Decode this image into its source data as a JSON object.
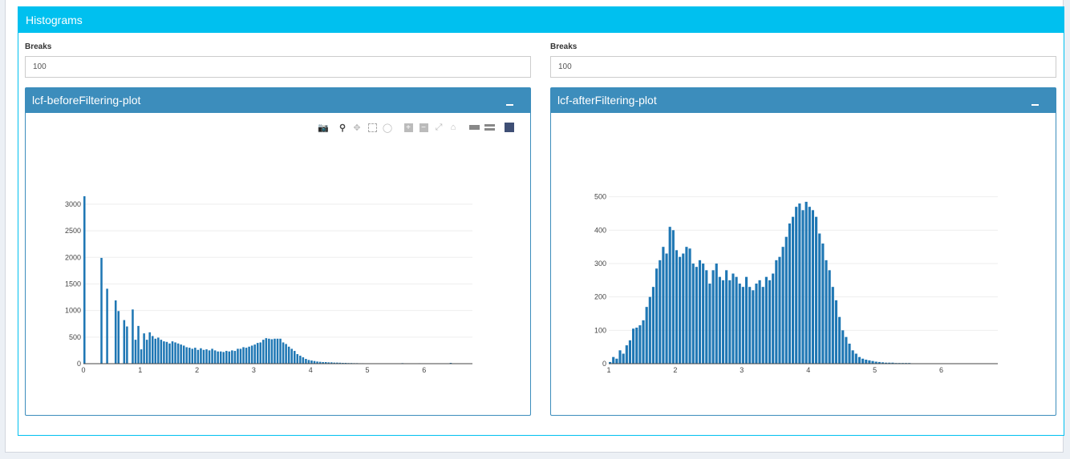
{
  "main_box": {
    "title": "Histograms"
  },
  "left": {
    "breaks_label": "Breaks",
    "breaks_value": "100",
    "plot_title": "lcf-beforeFiltering-plot"
  },
  "right": {
    "breaks_label": "Breaks",
    "breaks_value": "100",
    "plot_title": "lcf-afterFiltering-plot"
  },
  "modebar": [
    "camera-icon",
    "zoom-icon",
    "pan-icon",
    "box-select-icon",
    "lasso-icon",
    "zoom-in-icon",
    "zoom-out-icon",
    "autoscale-icon",
    "reset-axes-icon",
    "spike-lines-icon",
    "compare-hover-icon",
    "plotly-logo-icon"
  ],
  "colors": {
    "header": "#00c0ef",
    "plot_header": "#3c8dbc",
    "bar": "#1f77b4"
  },
  "chart_data": [
    {
      "type": "bar",
      "title": "",
      "xlabel": "",
      "ylabel": "",
      "xlim": [
        0,
        6.85
      ],
      "ylim": [
        0,
        3300
      ],
      "xticks": [
        0,
        1,
        2,
        3,
        4,
        5,
        6
      ],
      "yticks": [
        0,
        500,
        1000,
        1500,
        2000,
        2500,
        3000
      ],
      "bin_width": 0.05,
      "x_start": 0,
      "values": [
        3150,
        0,
        0,
        0,
        0,
        0,
        1990,
        0,
        1410,
        0,
        0,
        1190,
        990,
        0,
        820,
        700,
        0,
        1020,
        450,
        710,
        270,
        570,
        450,
        590,
        520,
        470,
        490,
        450,
        420,
        410,
        380,
        420,
        400,
        380,
        360,
        340,
        310,
        300,
        280,
        300,
        260,
        290,
        260,
        270,
        250,
        280,
        250,
        230,
        230,
        220,
        240,
        230,
        250,
        240,
        280,
        280,
        310,
        300,
        320,
        340,
        360,
        390,
        400,
        450,
        480,
        470,
        460,
        470,
        470,
        470,
        400,
        370,
        320,
        280,
        240,
        180,
        150,
        120,
        90,
        70,
        60,
        50,
        40,
        35,
        30,
        30,
        25,
        25,
        20,
        20,
        18,
        15,
        15,
        12,
        12,
        10,
        10,
        8,
        8,
        6,
        6,
        5,
        5,
        4,
        4,
        3,
        3,
        3,
        2,
        2,
        2,
        2,
        10,
        0,
        0,
        5,
        0,
        0,
        8,
        0,
        0,
        0,
        0,
        0,
        0,
        0,
        0,
        0,
        0,
        15
      ]
    },
    {
      "type": "bar",
      "title": "",
      "xlabel": "",
      "ylabel": "",
      "xlim": [
        1,
        6.85
      ],
      "ylim": [
        0,
        540
      ],
      "xticks": [
        1,
        2,
        3,
        4,
        5,
        6
      ],
      "yticks": [
        0,
        100,
        200,
        300,
        400,
        500
      ],
      "bin_width": 0.05,
      "x_start": 1,
      "values": [
        5,
        20,
        15,
        40,
        30,
        55,
        70,
        105,
        108,
        115,
        130,
        170,
        200,
        230,
        285,
        310,
        350,
        330,
        410,
        400,
        340,
        320,
        330,
        350,
        345,
        300,
        290,
        310,
        300,
        280,
        240,
        280,
        300,
        260,
        250,
        280,
        250,
        270,
        260,
        240,
        230,
        260,
        230,
        220,
        240,
        250,
        230,
        260,
        250,
        270,
        310,
        320,
        350,
        380,
        420,
        440,
        470,
        480,
        460,
        485,
        470,
        460,
        440,
        390,
        360,
        310,
        280,
        230,
        190,
        140,
        100,
        80,
        60,
        40,
        30,
        20,
        15,
        12,
        10,
        8,
        6,
        5,
        4,
        3,
        3,
        3,
        2,
        2,
        2,
        2,
        2,
        1,
        1,
        1,
        1,
        1,
        1,
        1,
        1,
        1,
        1,
        1,
        1,
        1,
        1,
        1,
        1,
        1,
        1,
        1,
        1,
        1,
        1,
        1,
        1,
        1,
        1
      ]
    }
  ]
}
